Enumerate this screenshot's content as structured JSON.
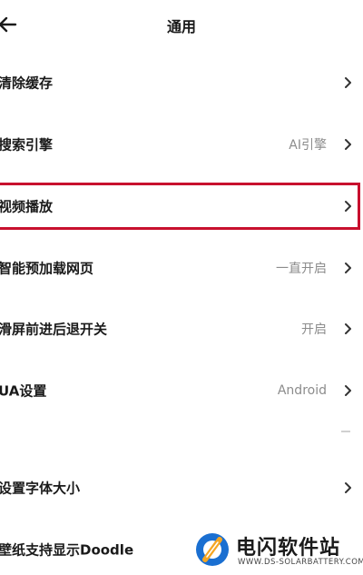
{
  "header": {
    "title": "通用",
    "back_icon": "arrow-left-icon"
  },
  "settings": [
    {
      "label": "清除缓存",
      "value": ""
    },
    {
      "label": "搜索引擎",
      "value": "AI引擎"
    },
    {
      "label": "视频播放",
      "value": ""
    },
    {
      "label": "智能预加载网页",
      "value": "一直开启"
    },
    {
      "label": "滑屏前进后退开关",
      "value": "开启"
    },
    {
      "label": "UA设置",
      "value": "Android"
    },
    {
      "label": "设置字体大小",
      "value": ""
    },
    {
      "label": "壁纸支持显示Doodle",
      "value": ""
    }
  ],
  "highlight_color": "#c8102e",
  "watermark": {
    "name": "电闪软件站",
    "url": "WWW.DS-SOLARBATTERY.COM",
    "logo_colors": [
      "#1a6fd1",
      "#f5a623"
    ]
  }
}
